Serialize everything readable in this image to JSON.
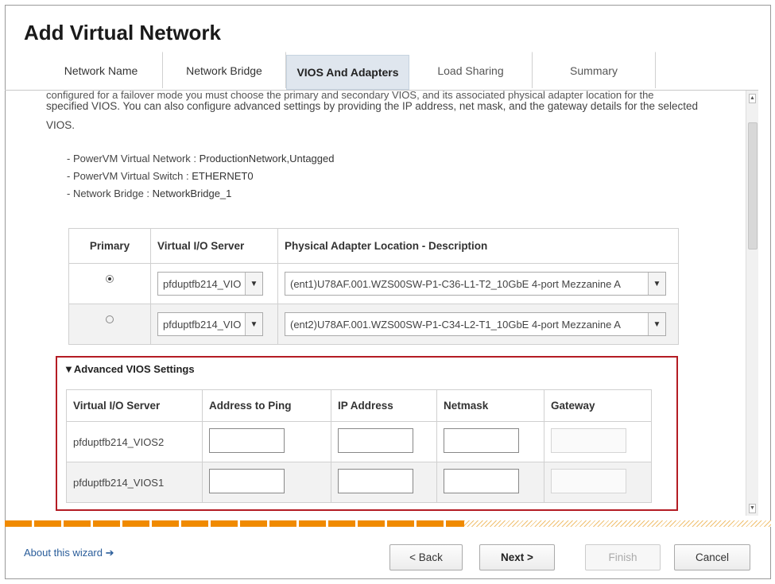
{
  "wizard": {
    "title": "Add Virtual Network",
    "tabs": [
      {
        "label": "Network Name"
      },
      {
        "label": "Network Bridge"
      },
      {
        "label": "VIOS And Adapters"
      },
      {
        "label": "Load Sharing"
      },
      {
        "label": "Summary"
      }
    ],
    "active_tab": 2
  },
  "intro": {
    "line1": "configured for a failover mode you must choose the primary and secondary VIOS, and its associated physical adapter location for the",
    "rest": "specified VIOS. You can also configure advanced settings by providing the IP address, net mask, and the gateway details for the selected VIOS."
  },
  "info": [
    {
      "key": "- PowerVM Virtual Network :",
      "value": "ProductionNetwork,Untagged"
    },
    {
      "key": "- PowerVM Virtual Switch :",
      "value": "ETHERNET0"
    },
    {
      "key": "- Network Bridge :",
      "value": "NetworkBridge_1"
    }
  ],
  "vios_table": {
    "headers": [
      "Primary",
      "Virtual I/O Server",
      "Physical Adapter Location - Description"
    ],
    "rows": [
      {
        "primary": true,
        "vios": "pfduptfb214_VIO",
        "adapter": "(ent1)U78AF.001.WZS00SW-P1-C36-L1-T2_10GbE 4-port Mezzanine A"
      },
      {
        "primary": false,
        "vios": "pfduptfb214_VIO",
        "adapter": "(ent2)U78AF.001.WZS00SW-P1-C34-L2-T1_10GbE 4-port Mezzanine A"
      }
    ]
  },
  "advanced": {
    "title": "▼Advanced VIOS Settings",
    "headers": [
      "Virtual I/O Server",
      "Address to Ping",
      "IP Address",
      "Netmask",
      "Gateway"
    ],
    "rows": [
      {
        "vios": "pfduptfb214_VIOS2"
      },
      {
        "vios": "pfduptfb214_VIOS1"
      }
    ]
  },
  "progress": {
    "fraction": 0.6
  },
  "footer": {
    "about": "About this wizard ➔",
    "back": "< Back",
    "next": "Next >",
    "finish": "Finish",
    "cancel": "Cancel"
  },
  "colors": {
    "accent": "#f08a00",
    "highlight_border": "#b41c24",
    "active_tab": "#dfe6ee"
  }
}
